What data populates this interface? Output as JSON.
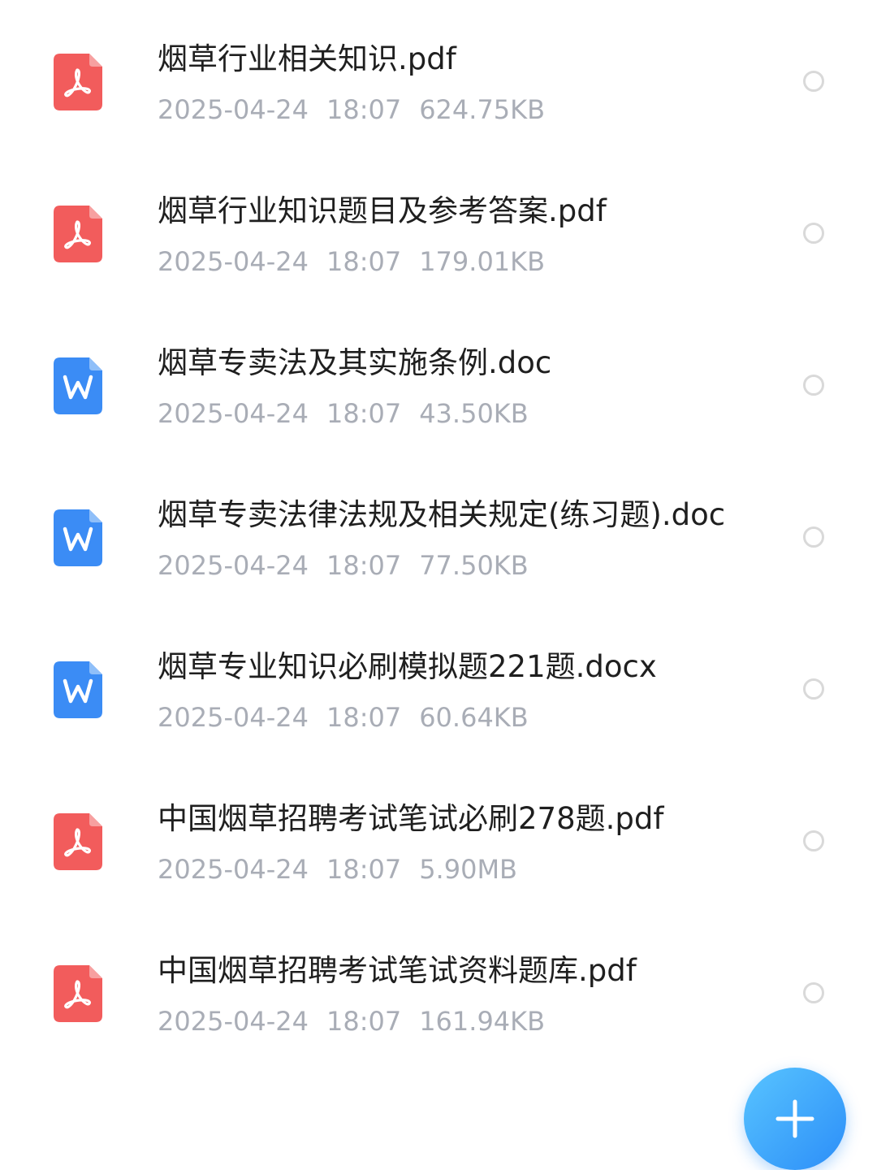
{
  "files": [
    {
      "name": "烟草行业相关知识.pdf",
      "date": "2025-04-24",
      "time": "18:07",
      "size": "624.75KB",
      "icon": "pdf-icon",
      "selected": false
    },
    {
      "name": "烟草行业知识题目及参考答案.pdf",
      "date": "2025-04-24",
      "time": "18:07",
      "size": "179.01KB",
      "icon": "pdf-icon",
      "selected": false
    },
    {
      "name": "烟草专卖法及其实施条例.doc",
      "date": "2025-04-24",
      "time": "18:07",
      "size": "43.50KB",
      "icon": "word-icon",
      "selected": false
    },
    {
      "name": "烟草专卖法律法规及相关规定(练习题).doc",
      "date": "2025-04-24",
      "time": "18:07",
      "size": "77.50KB",
      "icon": "word-icon",
      "selected": false
    },
    {
      "name": "烟草专业知识必刷模拟题221题.docx",
      "date": "2025-04-24",
      "time": "18:07",
      "size": "60.64KB",
      "icon": "word-icon",
      "selected": false
    },
    {
      "name": "中国烟草招聘考试笔试必刷278题.pdf",
      "date": "2025-04-24",
      "time": "18:07",
      "size": "5.90MB",
      "icon": "pdf-icon",
      "selected": false
    },
    {
      "name": "中国烟草招聘考试笔试资料题库.pdf",
      "date": "2025-04-24",
      "time": "18:07",
      "size": "161.94KB",
      "icon": "pdf-icon",
      "selected": false
    }
  ],
  "fab": {
    "icon": "plus-icon"
  },
  "colors": {
    "pdf": "#f25c5c",
    "word": "#3b8cf5",
    "fab_accent": "#2c8ef8",
    "meta_text": "#a9adb6",
    "name_text": "#1f1f1f"
  }
}
